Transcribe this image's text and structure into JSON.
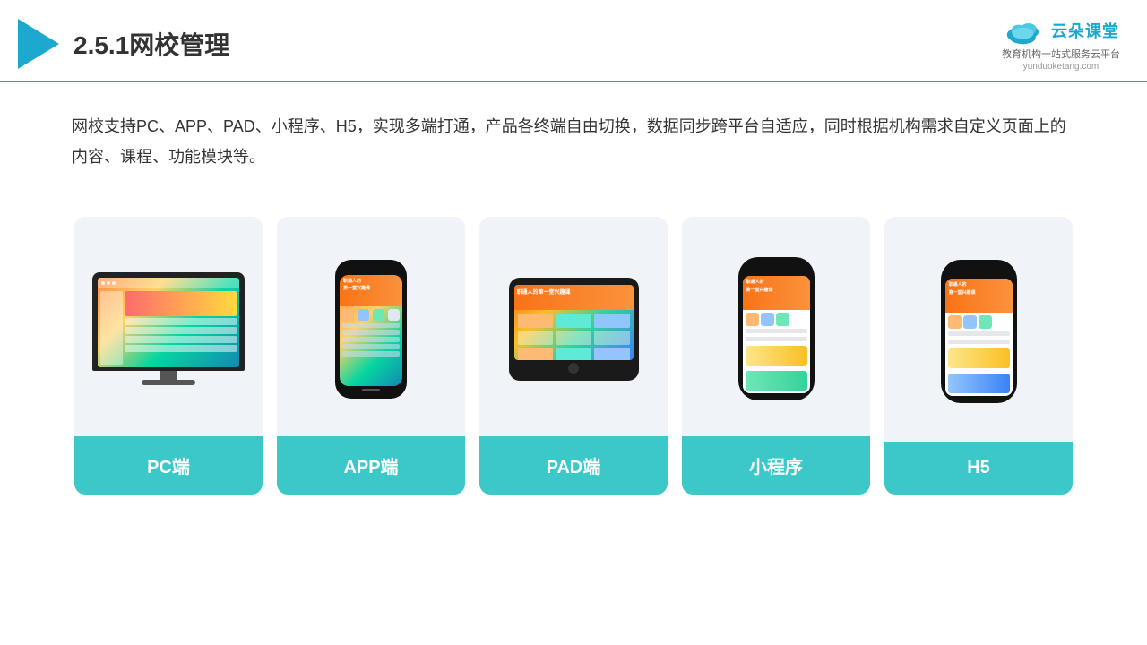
{
  "header": {
    "title": "2.5.1网校管理",
    "brand_name": "云朵课堂",
    "brand_sub": "教育机构一站\n式服务云平台",
    "brand_url": "yunduoketang.com"
  },
  "description": {
    "text": "网校支持PC、APP、PAD、小程序、H5，实现多端打通，产品各终端自由切换，数据同步跨平台自适应，同时根据机构需求自定义页面上的内容、课程、功能模块等。"
  },
  "cards": [
    {
      "id": "pc",
      "label": "PC端"
    },
    {
      "id": "app",
      "label": "APP端"
    },
    {
      "id": "pad",
      "label": "PAD端"
    },
    {
      "id": "miniprogram",
      "label": "小程序"
    },
    {
      "id": "h5",
      "label": "H5"
    }
  ]
}
